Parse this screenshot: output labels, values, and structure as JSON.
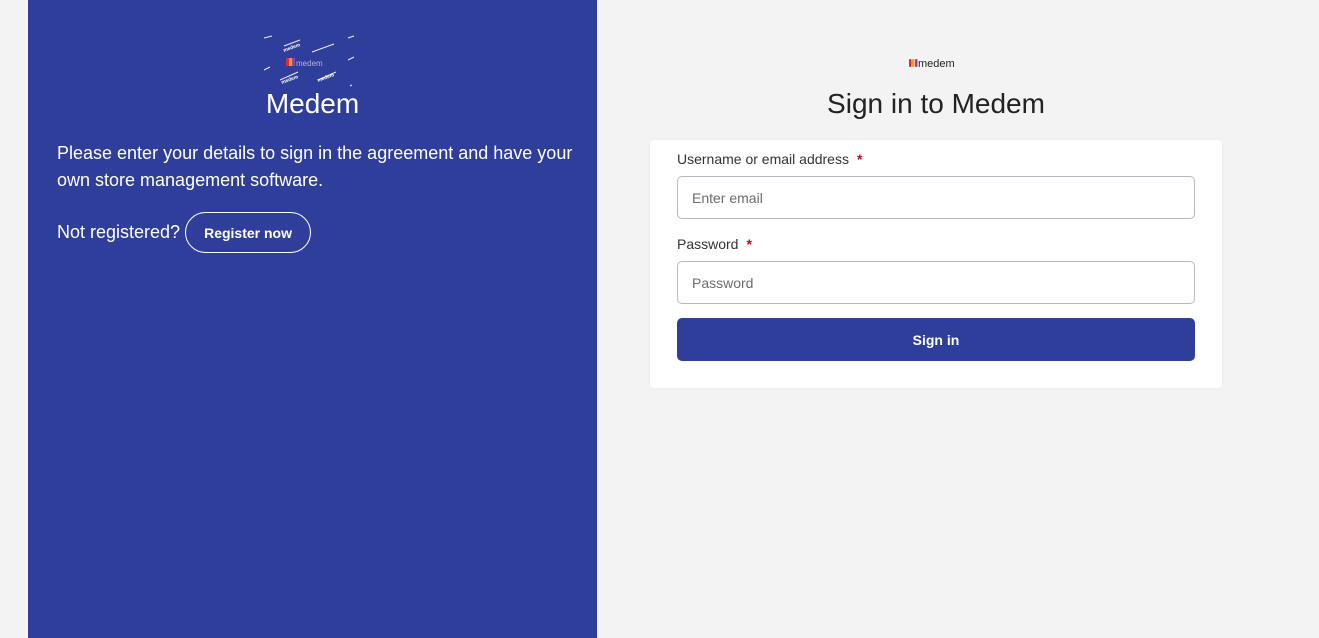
{
  "brand": {
    "name": "Medem",
    "logo_text": "medem",
    "primary_color": "#303e9b",
    "logo_colors": [
      "#e8243c",
      "#f39c12",
      "#8e44ad"
    ]
  },
  "left_panel": {
    "title": "Medem",
    "description": "Please enter your details to sign in the agreement and have your own store management software.",
    "not_registered_text": "Not registered?",
    "register_button_label": "Register now"
  },
  "form": {
    "title": "Sign in to Medem",
    "username_label": "Username or email address",
    "username_placeholder": "Enter email",
    "username_value": "",
    "password_label": "Password",
    "password_placeholder": "Password",
    "password_value": "",
    "required_marker": "*",
    "submit_label": "Sign in"
  }
}
